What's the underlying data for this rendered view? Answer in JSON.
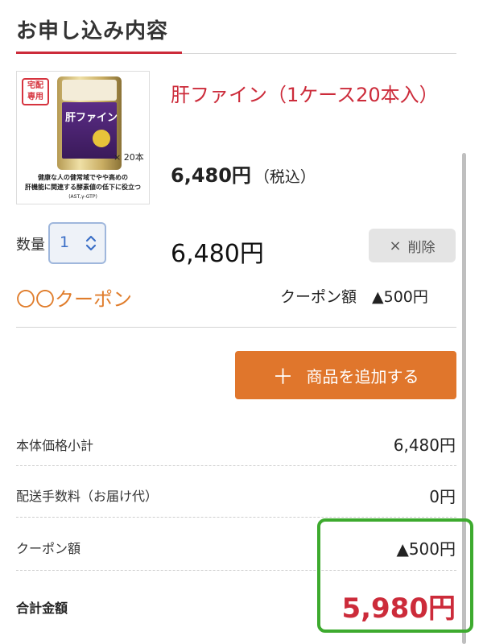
{
  "section": {
    "title": "お申し込み内容"
  },
  "product": {
    "image": {
      "badge": "宅配\n専用",
      "can_label": "肝ファイン",
      "quantity_mark": "× 20本",
      "caption_line1": "健康な人の健常域でやや高めの",
      "caption_line2": "肝機能に関連する酵素値の低下に役立つ",
      "caption_line3": "(AST,γ-GTP)"
    },
    "name": "肝ファイン（1ケース20本入）",
    "unit_price": "6,480円",
    "tax_note": "（税込）",
    "quantity_label": "数量",
    "quantity_value": "1",
    "line_total": "6,480円",
    "delete_label": "削除",
    "delete_icon": "×"
  },
  "coupon": {
    "name": "〇〇クーポン",
    "amount_text": "クーポン額　▲500円"
  },
  "add_button": {
    "icon": "＋",
    "label": "商品を追加する"
  },
  "summary": {
    "rows": [
      {
        "label": "本体価格小計",
        "value": "6,480円"
      },
      {
        "label": "配送手数料（お届け代）",
        "value": "0円"
      },
      {
        "label": "クーポン額",
        "value": "▲500円"
      }
    ],
    "total_label": "合計金額",
    "total_value": "5,980円"
  },
  "colors": {
    "accent_red": "#cc2b3a",
    "coupon_orange": "#e07d2c",
    "button_orange": "#e0762c",
    "highlight_green": "#3daa2e",
    "select_blue": "#3b6fc7"
  }
}
